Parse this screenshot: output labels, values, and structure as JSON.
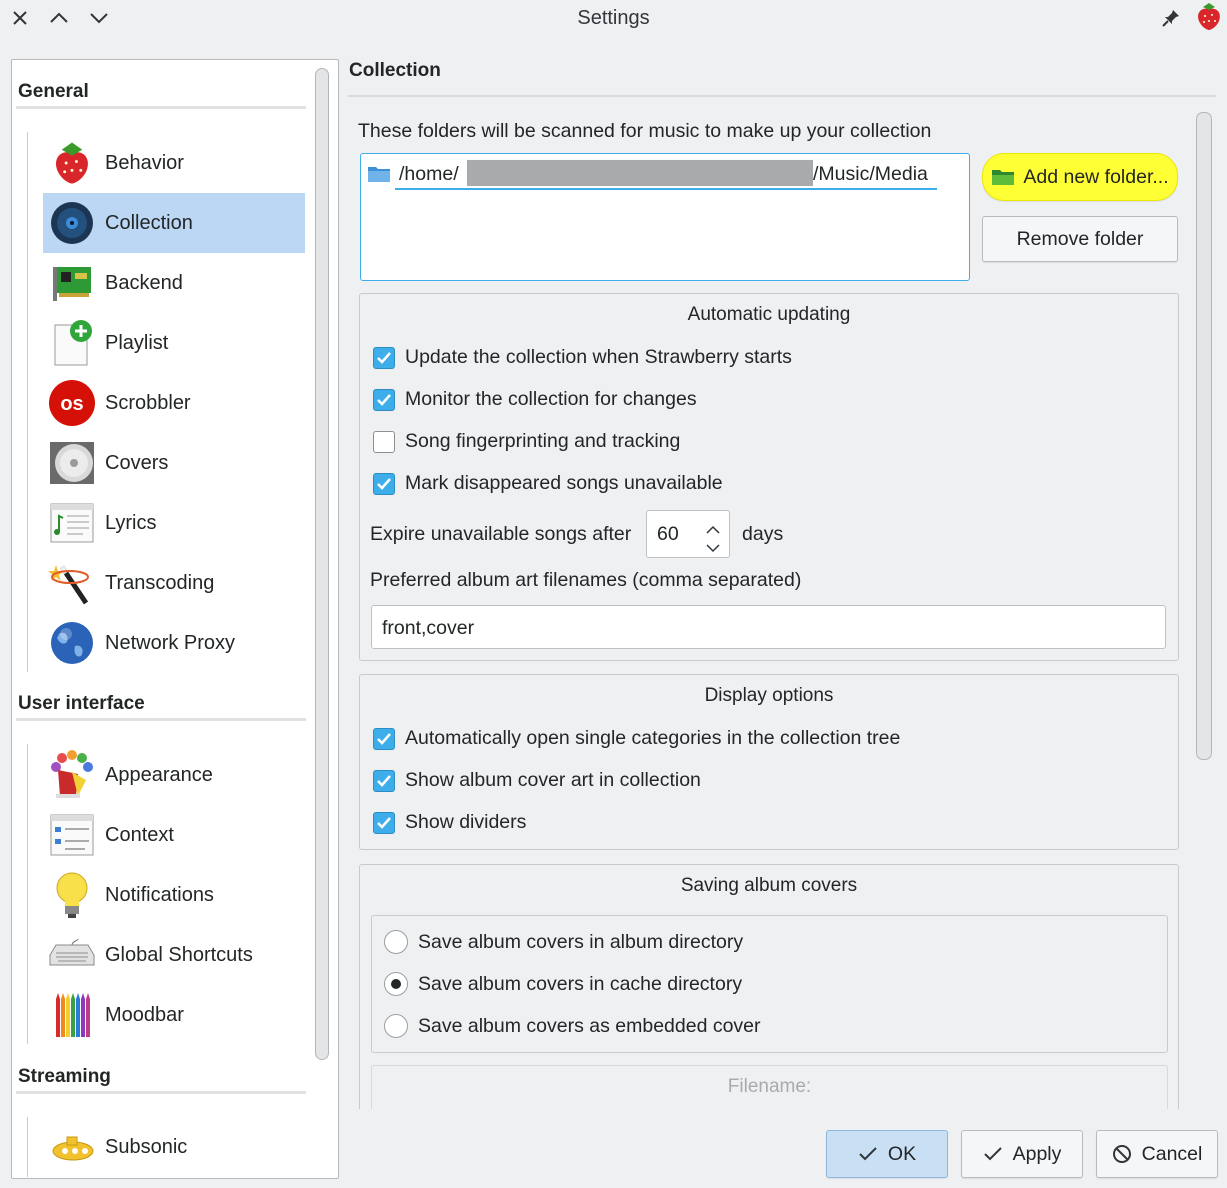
{
  "window": {
    "title": "Settings",
    "controls": {
      "close": "close-icon",
      "up": "chevron-up-icon",
      "down": "chevron-down-icon",
      "pin": "pin-icon",
      "app_icon": "strawberry-icon"
    }
  },
  "sidebar": {
    "sections": [
      {
        "title": "General",
        "items": [
          {
            "label": "Behavior",
            "icon": "strawberry-icon"
          },
          {
            "label": "Collection",
            "icon": "disc-icon",
            "selected": true
          },
          {
            "label": "Backend",
            "icon": "sound-card-icon"
          },
          {
            "label": "Playlist",
            "icon": "playlist-add-icon"
          },
          {
            "label": "Scrobbler",
            "icon": "lastfm-icon"
          },
          {
            "label": "Covers",
            "icon": "cd-icon"
          },
          {
            "label": "Lyrics",
            "icon": "lyrics-icon"
          },
          {
            "label": "Transcoding",
            "icon": "magic-wand-icon"
          },
          {
            "label": "Network Proxy",
            "icon": "globe-icon"
          }
        ]
      },
      {
        "title": "User interface",
        "items": [
          {
            "label": "Appearance",
            "icon": "paint-icon"
          },
          {
            "label": "Context",
            "icon": "context-icon"
          },
          {
            "label": "Notifications",
            "icon": "lightbulb-icon"
          },
          {
            "label": "Global Shortcuts",
            "icon": "keyboard-icon"
          },
          {
            "label": "Moodbar",
            "icon": "crayons-icon"
          }
        ]
      },
      {
        "title": "Streaming",
        "items": [
          {
            "label": "Subsonic",
            "icon": "submarine-icon"
          }
        ]
      }
    ]
  },
  "page": {
    "title": "Collection",
    "folders_label": "These folders will be scanned for music to make up your collection",
    "folders": [
      {
        "path_prefix": "/home/",
        "path_suffix": "/Music/Media",
        "icon": "folder-icon"
      }
    ],
    "add_folder_label": "Add new folder...",
    "remove_folder_label": "Remove folder",
    "auto_update": {
      "title": "Automatic updating",
      "options": [
        {
          "label": "Update the collection when Strawberry starts",
          "checked": true
        },
        {
          "label": "Monitor the collection for changes",
          "checked": true
        },
        {
          "label": "Song fingerprinting and tracking",
          "checked": false
        },
        {
          "label": "Mark disappeared songs unavailable",
          "checked": true
        }
      ],
      "expire_label": "Expire unavailable songs after",
      "expire_value": "60",
      "expire_unit": "days",
      "filenames_label": "Preferred album art filenames (comma separated)",
      "filenames_value": "front,cover"
    },
    "display": {
      "title": "Display options",
      "options": [
        {
          "label": "Automatically open single categories in the collection tree",
          "checked": true
        },
        {
          "label": "Show album cover art in collection",
          "checked": true
        },
        {
          "label": "Show dividers",
          "checked": true
        }
      ]
    },
    "covers": {
      "title": "Saving album covers",
      "options": [
        {
          "label": "Save album covers in album directory",
          "selected": false
        },
        {
          "label": "Save album covers in cache directory",
          "selected": true
        },
        {
          "label": "Save album covers as embedded cover",
          "selected": false
        }
      ],
      "filename_label": "Filename:"
    }
  },
  "buttons": {
    "ok": "OK",
    "apply": "Apply",
    "cancel": "Cancel"
  },
  "colors": {
    "selection": "#bcd7f3",
    "accent": "#3daee9",
    "highlight": "#ffff00"
  }
}
